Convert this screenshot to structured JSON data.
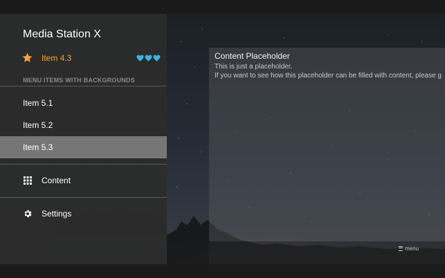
{
  "app": {
    "title": "Media Station X"
  },
  "featured_item": {
    "label": "Item 4.3",
    "icon": "star-icon",
    "accent_color": "#f3a43a",
    "hearts": 3,
    "heart_color": "#39b5e0"
  },
  "section": {
    "header": "MENU ITEMS WITH BACKGROUNDS"
  },
  "menu_items": [
    {
      "label": "Item 5.1"
    },
    {
      "label": "Item 5.2"
    },
    {
      "label": "Item 5.3",
      "selected": true
    }
  ],
  "nav": {
    "content": {
      "label": "Content",
      "icon": "grid-icon"
    },
    "settings": {
      "label": "Settings",
      "icon": "gear-icon"
    }
  },
  "content_panel": {
    "title": "Content Placeholder",
    "line1": "This is just a placeholder.",
    "line2": "If you want to see how this placeholder can be filled with content, please g"
  },
  "footer": {
    "menu_hint": "menu",
    "icon": "menu-icon"
  }
}
